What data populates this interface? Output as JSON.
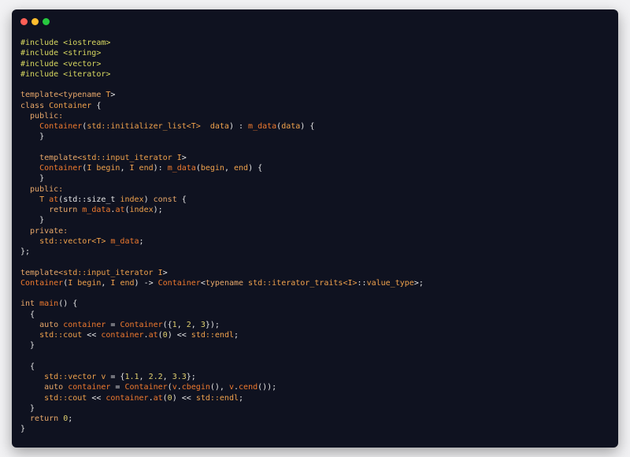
{
  "window": {
    "title": "",
    "controls": [
      {
        "name": "close-button",
        "color": "#ff5f56"
      },
      {
        "name": "minimize-button",
        "color": "#ffbd2e"
      },
      {
        "name": "maximize-button",
        "color": "#27c93f"
      }
    ]
  },
  "colors": {
    "background": "#0f1220",
    "preprocessor": "#d8d860",
    "keyword": "#e8a86a",
    "type": "#f0a24c",
    "function": "#f07a2e",
    "plain": "#e6e6e6",
    "number": "#e0d070"
  },
  "code": {
    "language": "C++",
    "lines": [
      [
        [
          "pre",
          "#include <iostream>"
        ]
      ],
      [
        [
          "pre",
          "#include <string>"
        ]
      ],
      [
        [
          "pre",
          "#include <vector>"
        ]
      ],
      [
        [
          "pre",
          "#include <iterator>"
        ]
      ],
      [],
      [
        [
          "kw",
          "template<typename "
        ],
        [
          "type",
          "T"
        ],
        [
          "plain",
          ">"
        ]
      ],
      [
        [
          "kw",
          "class "
        ],
        [
          "type",
          "Container"
        ],
        [
          "plain",
          " {"
        ]
      ],
      [
        [
          "kw",
          "  public:"
        ]
      ],
      [
        [
          "fn",
          "    Container"
        ],
        [
          "plain",
          "("
        ],
        [
          "type",
          "std::initializer_list<T>"
        ],
        [
          "plain",
          "  "
        ],
        [
          "type",
          "data"
        ],
        [
          "plain",
          ") : "
        ],
        [
          "fn",
          "m_data"
        ],
        [
          "plain",
          "("
        ],
        [
          "type",
          "data"
        ],
        [
          "plain",
          ") {"
        ]
      ],
      [
        [
          "plain",
          "    }"
        ]
      ],
      [],
      [
        [
          "kw",
          "    template<"
        ],
        [
          "type",
          "std::input_iterator I"
        ],
        [
          "plain",
          ">"
        ]
      ],
      [
        [
          "fn",
          "    Container"
        ],
        [
          "plain",
          "("
        ],
        [
          "type",
          "I begin"
        ],
        [
          "plain",
          ", "
        ],
        [
          "type",
          "I end"
        ],
        [
          "plain",
          "): "
        ],
        [
          "fn",
          "m_data"
        ],
        [
          "plain",
          "("
        ],
        [
          "type",
          "begin"
        ],
        [
          "plain",
          ", "
        ],
        [
          "type",
          "end"
        ],
        [
          "plain",
          ") {"
        ]
      ],
      [
        [
          "plain",
          "    }"
        ]
      ],
      [
        [
          "kw",
          "  public:"
        ]
      ],
      [
        [
          "type",
          "    T "
        ],
        [
          "fn",
          "at"
        ],
        [
          "plain",
          "(std::size_t "
        ],
        [
          "type",
          "index"
        ],
        [
          "plain",
          ") "
        ],
        [
          "kw",
          "const"
        ],
        [
          "plain",
          " {"
        ]
      ],
      [
        [
          "kw",
          "      return "
        ],
        [
          "fn",
          "m_data"
        ],
        [
          "plain",
          "."
        ],
        [
          "fn",
          "at"
        ],
        [
          "plain",
          "("
        ],
        [
          "type",
          "index"
        ],
        [
          "plain",
          ");"
        ]
      ],
      [
        [
          "plain",
          "    }"
        ]
      ],
      [
        [
          "kw",
          "  private:"
        ]
      ],
      [
        [
          "type",
          "    std::vector<T> "
        ],
        [
          "fn",
          "m_data"
        ],
        [
          "plain",
          ";"
        ]
      ],
      [
        [
          "plain",
          "};"
        ]
      ],
      [],
      [
        [
          "kw",
          "template<"
        ],
        [
          "type",
          "std::input_iterator I"
        ],
        [
          "plain",
          ">"
        ]
      ],
      [
        [
          "fn",
          "Container"
        ],
        [
          "plain",
          "("
        ],
        [
          "type",
          "I begin"
        ],
        [
          "plain",
          ", "
        ],
        [
          "type",
          "I end"
        ],
        [
          "plain",
          ") -> "
        ],
        [
          "fn",
          "Container"
        ],
        [
          "plain",
          "<"
        ],
        [
          "kw",
          "typename "
        ],
        [
          "type",
          "std::iterator_traits<I>"
        ],
        [
          "plain",
          "::"
        ],
        [
          "type",
          "value_type"
        ],
        [
          "plain",
          ">;"
        ]
      ],
      [],
      [
        [
          "kw",
          "int "
        ],
        [
          "fn",
          "main"
        ],
        [
          "plain",
          "() {"
        ]
      ],
      [
        [
          "plain",
          "  {"
        ]
      ],
      [
        [
          "kw",
          "    auto "
        ],
        [
          "fn",
          "container"
        ],
        [
          "plain",
          " = "
        ],
        [
          "fn",
          "Container"
        ],
        [
          "plain",
          "({"
        ],
        [
          "num",
          "1"
        ],
        [
          "plain",
          ", "
        ],
        [
          "num",
          "2"
        ],
        [
          "plain",
          ", "
        ],
        [
          "num",
          "3"
        ],
        [
          "plain",
          "});"
        ]
      ],
      [
        [
          "type",
          "    std::cout "
        ],
        [
          "plain",
          "<< "
        ],
        [
          "fn",
          "container"
        ],
        [
          "plain",
          "."
        ],
        [
          "fn",
          "at"
        ],
        [
          "plain",
          "("
        ],
        [
          "num",
          "0"
        ],
        [
          "plain",
          ") << "
        ],
        [
          "type",
          "std::endl"
        ],
        [
          "plain",
          ";"
        ]
      ],
      [
        [
          "plain",
          "  }"
        ]
      ],
      [],
      [
        [
          "plain",
          "  {"
        ]
      ],
      [
        [
          "type",
          "     std::vector v"
        ],
        [
          "plain",
          " = {"
        ],
        [
          "num",
          "1.1"
        ],
        [
          "plain",
          ", "
        ],
        [
          "num",
          "2.2"
        ],
        [
          "plain",
          ", "
        ],
        [
          "num",
          "3.3"
        ],
        [
          "plain",
          "};"
        ]
      ],
      [
        [
          "kw",
          "     auto "
        ],
        [
          "fn",
          "container"
        ],
        [
          "plain",
          " = "
        ],
        [
          "fn",
          "Container"
        ],
        [
          "plain",
          "("
        ],
        [
          "fn",
          "v"
        ],
        [
          "plain",
          "."
        ],
        [
          "fn",
          "cbegin"
        ],
        [
          "plain",
          "(), "
        ],
        [
          "fn",
          "v"
        ],
        [
          "plain",
          "."
        ],
        [
          "fn",
          "cend"
        ],
        [
          "plain",
          "());"
        ]
      ],
      [
        [
          "type",
          "     std::cout "
        ],
        [
          "plain",
          "<< "
        ],
        [
          "fn",
          "container"
        ],
        [
          "plain",
          "."
        ],
        [
          "fn",
          "at"
        ],
        [
          "plain",
          "("
        ],
        [
          "num",
          "0"
        ],
        [
          "plain",
          ") << "
        ],
        [
          "type",
          "std::endl"
        ],
        [
          "plain",
          ";"
        ]
      ],
      [
        [
          "plain",
          "  }"
        ]
      ],
      [
        [
          "kw",
          "  return "
        ],
        [
          "num",
          "0"
        ],
        [
          "plain",
          ";"
        ]
      ],
      [
        [
          "plain",
          "}"
        ]
      ]
    ]
  }
}
